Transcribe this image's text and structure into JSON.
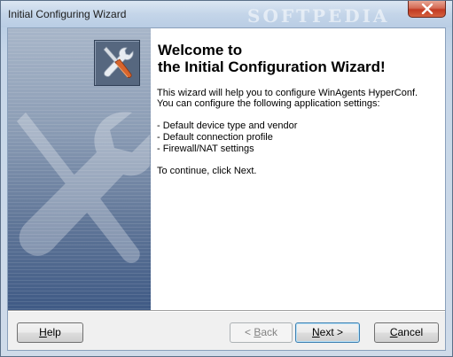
{
  "window": {
    "title": "Initial Configuring Wizard",
    "watermark": "SOFTPEDIA",
    "close_glyph": "✕"
  },
  "icons": {
    "close": "close-icon",
    "wizard": "wrench-screwdriver-icon"
  },
  "content": {
    "heading_line1": "Welcome to",
    "heading_line2": "the Initial Configuration Wizard!",
    "intro_line1": "This wizard will help you to configure WinAgents HyperConf.",
    "intro_line2": "You can configure the following application settings:",
    "bullets": [
      "-  Default device type and vendor",
      "-  Default connection profile",
      "-  Firewall/NAT settings"
    ],
    "continue_text": "To continue, click Next."
  },
  "buttons": {
    "help": {
      "mnemonic": "H",
      "rest": "elp"
    },
    "back": {
      "prefix": "< ",
      "mnemonic": "B",
      "rest": "ack"
    },
    "next": {
      "mnemonic": "N",
      "rest": "ext >"
    },
    "cancel": {
      "mnemonic": "C",
      "rest": "ancel"
    }
  },
  "colors": {
    "side_panel_top": "#a8b6c9",
    "side_panel_bottom": "#3f5a85",
    "close_red": "#c23a22"
  }
}
